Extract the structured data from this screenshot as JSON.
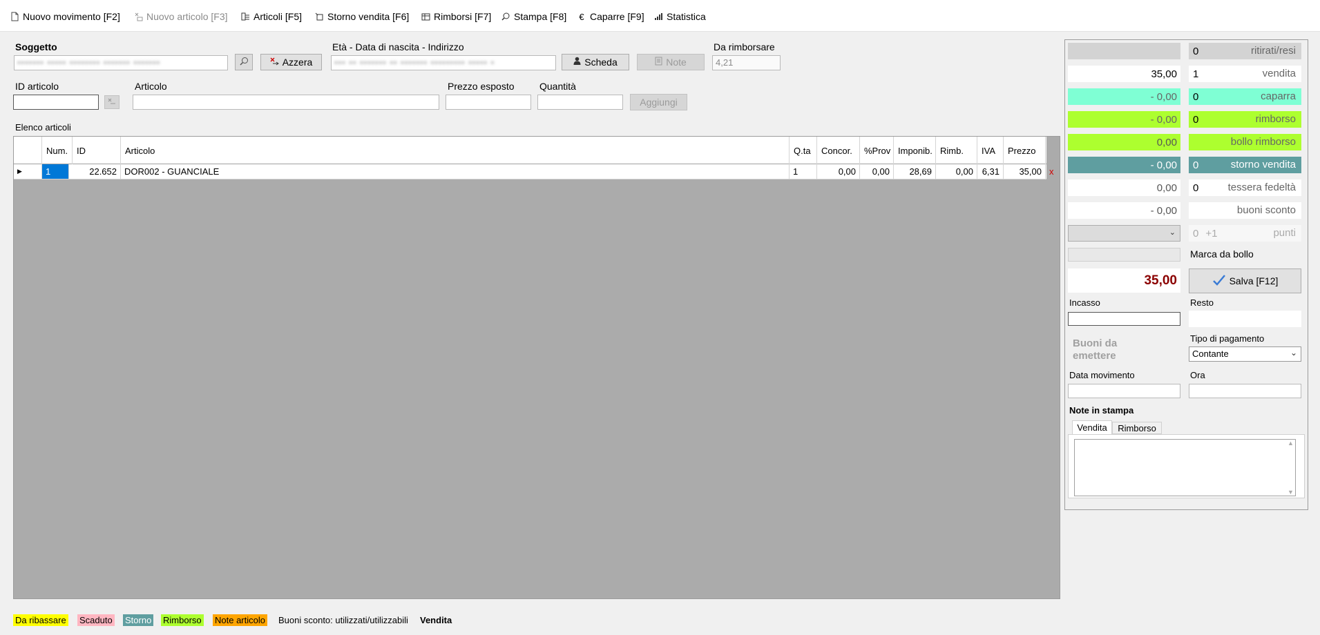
{
  "toolbar": {
    "new_movement": "Nuovo movimento [F2]",
    "new_article": "Nuovo articolo [F3]",
    "articles": "Articoli [F5]",
    "storno": "Storno vendita [F6]",
    "refunds": "Rimborsi [F7]",
    "print": "Stampa [F8]",
    "deposits": "Caparre [F9]",
    "stats": "Statistica"
  },
  "subject": {
    "label": "Soggetto",
    "value": "••••••• ••••• •••••••• ••••••• •••••••",
    "reset_label": "Azzera",
    "age_label": "Età - Data di nascita - Indirizzo",
    "age_value": "••• •• ••••••• •• ••••••• ••••••••• ••••• •",
    "card_label": "Scheda",
    "note_label": "Note",
    "refund_label": "Da rimborsare",
    "refund_value": "4,21"
  },
  "article_entry": {
    "id_label": "ID articolo",
    "article_label": "Articolo",
    "price_label": "Prezzo esposto",
    "qty_label": "Quantità",
    "add_label": "Aggiungi"
  },
  "list": {
    "title": "Elenco articoli",
    "headers": [
      "Num.",
      "ID",
      "Articolo",
      "Q.ta",
      "Concor.",
      "%Prov",
      "Imponib.",
      "Rimb.",
      "IVA",
      "Prezzo"
    ],
    "row": {
      "num": "1",
      "id": "22.652",
      "article": "DOR002 - GUANCIALE",
      "qty": "1",
      "concor": "0,00",
      "prov": "0,00",
      "taxable": "28,69",
      "refund": "0,00",
      "vat": "6,31",
      "price": "35,00",
      "delete": "x"
    }
  },
  "summary": {
    "returned": {
      "count": "0",
      "label": "ritirati/resi"
    },
    "sale": {
      "amount": "35,00",
      "count": "1",
      "label": "vendita"
    },
    "deposit": {
      "amount": "- 0,00",
      "count": "0",
      "label": "caparra"
    },
    "refund": {
      "amount": "- 0,00",
      "count": "0",
      "label": "rimborso"
    },
    "refund_stamp": {
      "amount": "0,00",
      "label": "bollo rimborso"
    },
    "storno": {
      "amount": "- 0,00",
      "count": "0",
      "label": "storno vendita"
    },
    "loyalty": {
      "amount": "0,00",
      "count": "0",
      "label": "tessera fedeltà"
    },
    "vouchers": {
      "amount": "- 0,00",
      "label": "buoni sconto"
    },
    "points": {
      "count": "0",
      "plus": "+1",
      "label": "punti"
    },
    "stamp_label": "Marca da bollo",
    "total": "35,00",
    "save_label": "Salva [F12]",
    "cash_label": "Incasso",
    "change_label": "Resto",
    "vouchers_to_issue": "Buoni da emettere",
    "payment_type_label": "Tipo di pagamento",
    "payment_type_value": "Contante",
    "date_label": "Data movimento",
    "time_label": "Ora",
    "print_notes_label": "Note in stampa",
    "tabs": [
      "Vendita",
      "Rimborso"
    ]
  },
  "legend": {
    "to_reduce": "Da ribassare",
    "expired": "Scaduto",
    "storno": "Storno",
    "refund": "Rimborso",
    "article_note": "Note articolo",
    "vouchers": "Buoni sconto: utilizzati/utilizzabili",
    "mode": "Vendita"
  },
  "colors": {
    "deposit": "#7fffd4",
    "refund": "#adff2f",
    "storno": "#5f9ea0",
    "to_reduce": "#ffff00",
    "expired": "#ffb6c1",
    "article_note": "#ffa500",
    "total_text": "#8b0000"
  }
}
